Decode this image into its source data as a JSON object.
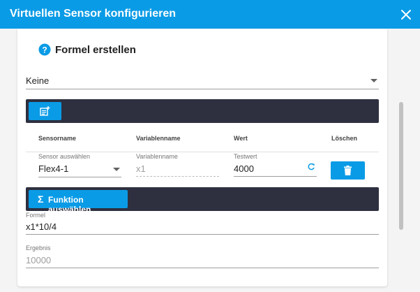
{
  "dialog": {
    "title": "Virtuellen Sensor konfigurieren"
  },
  "section": {
    "title": "Formel erstellen"
  },
  "preset_select": {
    "value": "Keine"
  },
  "table": {
    "headers": [
      "Sensorname",
      "Variablenname",
      "Wert",
      "Löschen"
    ],
    "row": {
      "sensor_label": "Sensor auswählen",
      "sensor_value": "Flex4-1",
      "variable_label": "Variablenname",
      "variable_placeholder": "x1",
      "test_label": "Testwert",
      "test_value": "4000"
    }
  },
  "function_button": {
    "label": "Funktion auswählen"
  },
  "formula": {
    "label": "Formel",
    "value": "x1*10/4"
  },
  "result": {
    "label": "Ergebnis",
    "value": "10000"
  },
  "colors": {
    "accent": "#0a9be6",
    "toolbar": "#2e3040"
  },
  "icons": [
    "close-icon",
    "help-icon",
    "add-note-icon",
    "refresh-icon",
    "trash-icon",
    "sigma-icon"
  ]
}
